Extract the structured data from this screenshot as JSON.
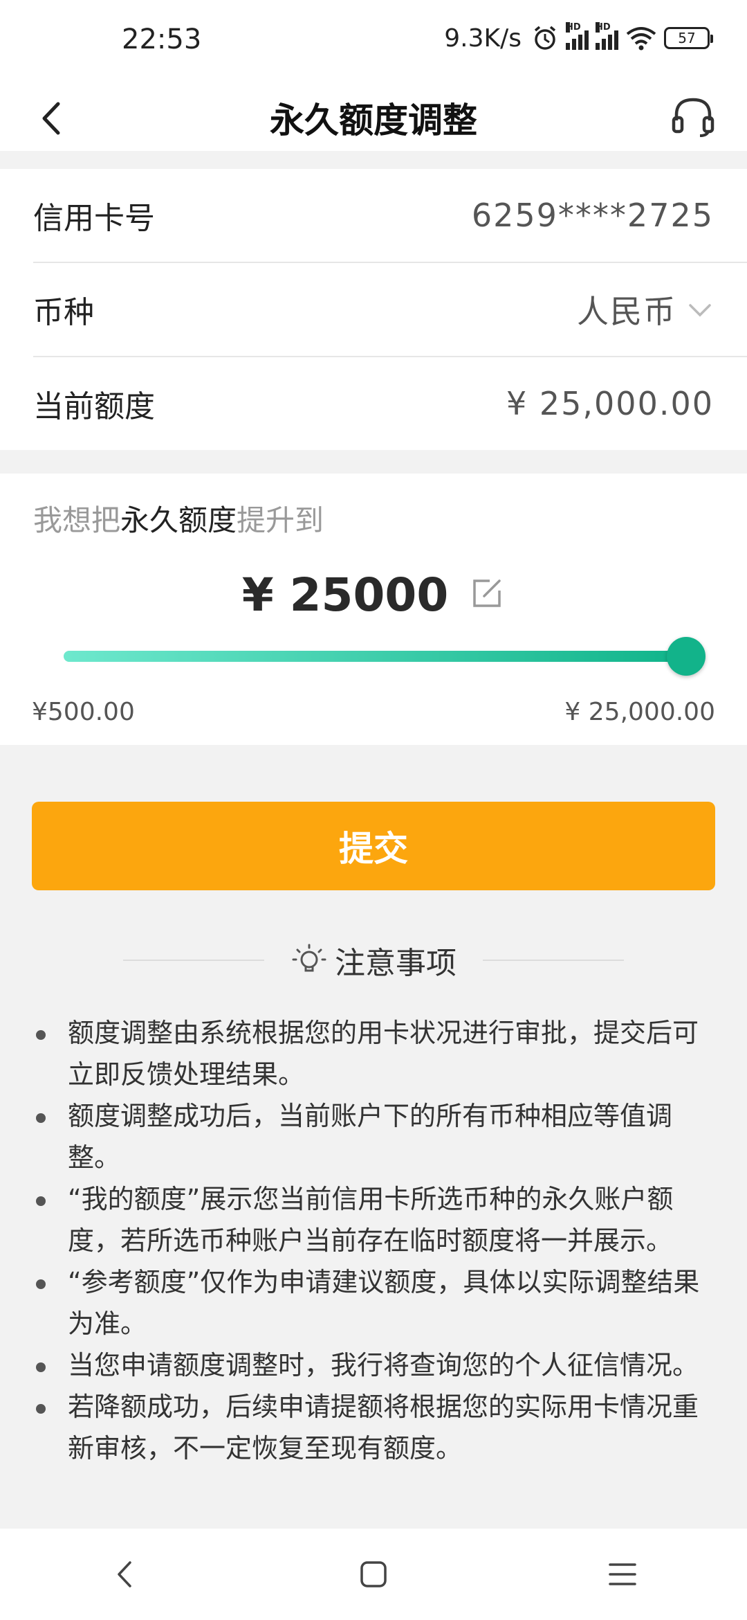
{
  "status_bar": {
    "time": "22:53",
    "net_speed": "9.3K/s",
    "hd_label": "HD",
    "battery": "57"
  },
  "header": {
    "title": "永久额度调整"
  },
  "card_info": {
    "card_number_label": "信用卡号",
    "card_number_value": "6259****2725",
    "currency_label": "币种",
    "currency_value": "人民币",
    "current_limit_label": "当前额度",
    "current_limit_value": "¥ 25,000.00"
  },
  "adjust": {
    "prompt_prefix": "我想把",
    "prompt_emphasis": "永久额度",
    "prompt_suffix": "提升到",
    "amount": "¥ 25000",
    "slider_fraction": 1.0,
    "min_label": "¥500.00",
    "max_label": "¥ 25,000.00"
  },
  "submit_label": "提交",
  "notes": {
    "title": "注意事项",
    "items": [
      "额度调整由系统根据您的用卡状况进行审批，提交后可立即反馈处理结果。",
      "额度调整成功后，当前账户下的所有币种相应等值调整。",
      "“我的额度”展示您当前信用卡所选币种的永久账户额度，若所选币种账户当前存在临时额度将一并展示。",
      "“参考额度”仅作为申请建议额度，具体以实际调整结果为准。",
      "当您申请额度调整时，我行将查询您的个人征信情况。",
      "若降额成功，后续申请提额将根据您的实际用卡情况重新审核，不一定恢复至现有额度。"
    ]
  },
  "colors": {
    "accent_orange": "#fca60e",
    "slider_green": "#12b38a",
    "slider_light": "#6ee8cd"
  },
  "icons": {
    "back": "chevron-left-icon",
    "support": "headset-icon",
    "currency_dropdown": "chevron-down-icon",
    "edit": "edit-icon",
    "notes": "lightbulb-icon",
    "nav_back": "nav-back-icon",
    "nav_home": "nav-home-icon",
    "nav_menu": "nav-menu-icon"
  }
}
